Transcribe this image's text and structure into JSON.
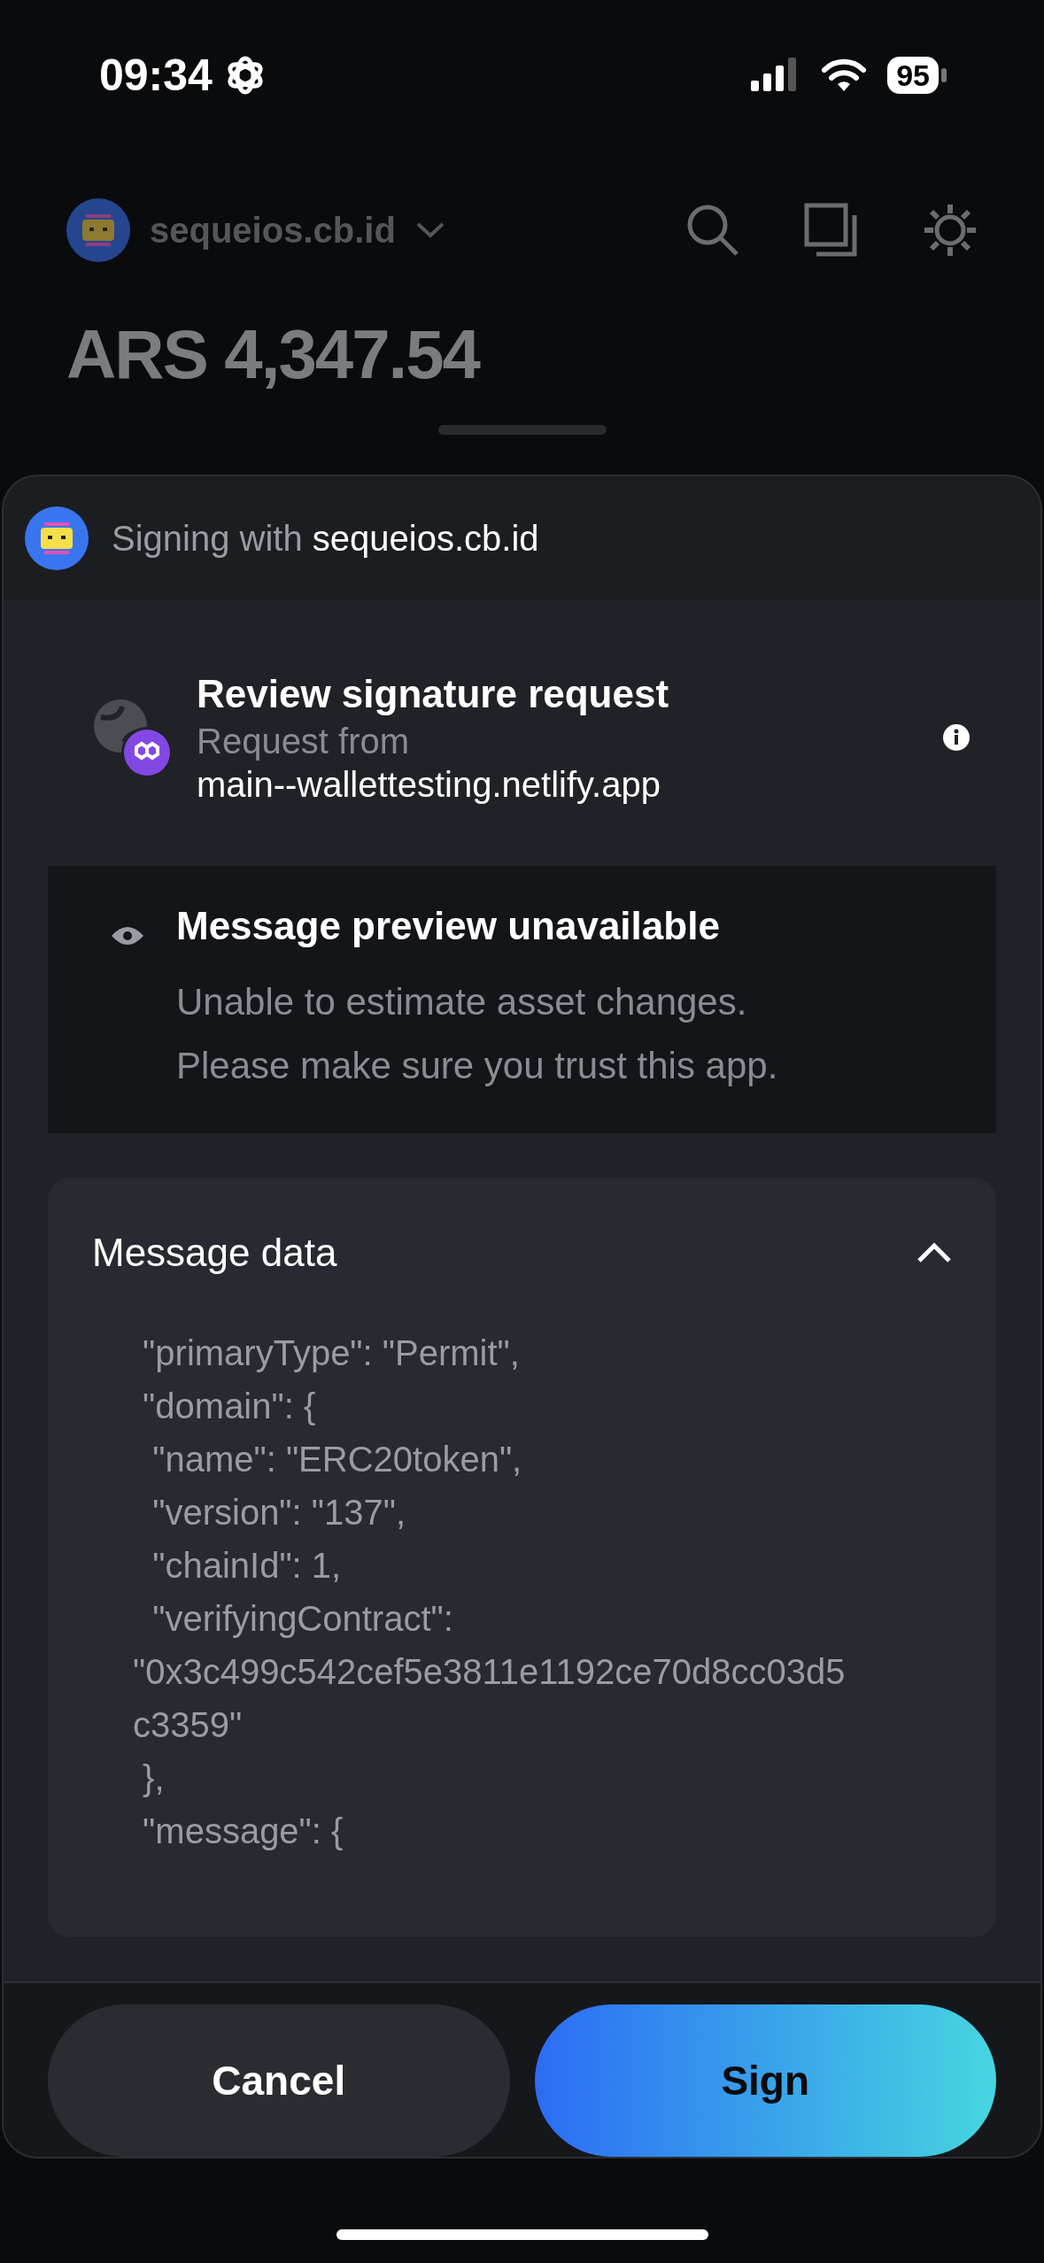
{
  "status_bar": {
    "time": "09:34",
    "battery": "95"
  },
  "header": {
    "account": "sequeios.cb.id",
    "balance": "ARS 4,347.54"
  },
  "sheet": {
    "signing_label": "Signing with",
    "signing_account": "sequeios.cb.id",
    "title": "Review signature request",
    "request_label": "Request from",
    "request_origin": "main--wallettesting.netlify.app",
    "preview": {
      "title": "Message preview unavailable",
      "lines": [
        "Unable to estimate asset changes.",
        "Please make sure you trust this app."
      ]
    },
    "message_data": {
      "title": "Message data",
      "expanded": true,
      "lines": [
        " \"primaryType\": \"Permit\",",
        " \"domain\": {",
        "  \"name\": \"ERC20token\",",
        "  \"version\": \"137\",",
        "  \"chainId\": 1,",
        "  \"verifyingContract\":",
        "\"0x3c499c542cef5e3811e1192ce70d8cc03d5",
        "c3359\"",
        " },",
        " \"message\": {"
      ]
    }
  },
  "buttons": [
    {
      "label": "Cancel",
      "kind": "secondary"
    },
    {
      "label": "Sign",
      "kind": "primary"
    }
  ]
}
